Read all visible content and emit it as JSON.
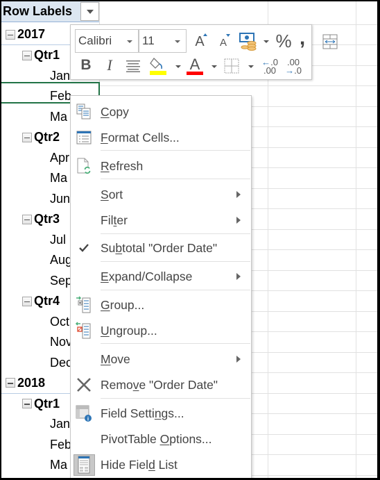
{
  "pivot": {
    "header_label": "Row Labels",
    "rows": [
      {
        "type": "year",
        "label": "2017"
      },
      {
        "type": "qtr",
        "label": "Qtr1"
      },
      {
        "type": "month",
        "label": "Jan"
      },
      {
        "type": "month",
        "label": "Feb"
      },
      {
        "type": "month",
        "label": "Ma"
      },
      {
        "type": "qtr",
        "label": "Qtr2"
      },
      {
        "type": "month",
        "label": "Apr"
      },
      {
        "type": "month",
        "label": "Ma"
      },
      {
        "type": "month",
        "label": "Jun"
      },
      {
        "type": "qtr",
        "label": "Qtr3"
      },
      {
        "type": "month",
        "label": "Jul"
      },
      {
        "type": "month",
        "label": "Aug"
      },
      {
        "type": "month",
        "label": "Sep"
      },
      {
        "type": "qtr",
        "label": "Qtr4"
      },
      {
        "type": "month",
        "label": "Oct"
      },
      {
        "type": "month",
        "label": "Nov"
      },
      {
        "type": "month",
        "label": "Dec"
      },
      {
        "type": "year",
        "label": "2018"
      },
      {
        "type": "qtr",
        "label": "Qtr1"
      },
      {
        "type": "month",
        "label": "Jan"
      },
      {
        "type": "month",
        "label": "Feb"
      },
      {
        "type": "month",
        "label": "Ma"
      }
    ]
  },
  "mini_toolbar": {
    "font_name": "Calibri",
    "font_size": "11",
    "highlight_color": "#ffff00",
    "font_color": "#ff0000",
    "buttons": {
      "increase_font": "A",
      "decrease_font": "A",
      "percent": "%",
      "comma": ",",
      "bold": "B",
      "italic": "I",
      "inc_decimal_top": ".0",
      "inc_decimal_bottom": ".00",
      "dec_decimal_top": ".00",
      "dec_decimal_bottom": ".0"
    }
  },
  "context_menu": {
    "items": [
      {
        "id": "copy",
        "pre": "",
        "u": "C",
        "post": "opy",
        "icon": "copy-icon"
      },
      {
        "id": "format-cells",
        "pre": "",
        "u": "F",
        "post": "ormat Cells...",
        "icon": "format-cells-icon"
      },
      {
        "id": "refresh",
        "pre": "",
        "u": "R",
        "post": "efresh",
        "icon": "refresh-icon"
      },
      {
        "id": "sort",
        "pre": "",
        "u": "S",
        "post": "ort",
        "submenu": true
      },
      {
        "id": "filter",
        "pre": "Fil",
        "u": "t",
        "post": "er",
        "submenu": true
      },
      {
        "id": "subtotal",
        "pre": "Su",
        "u": "b",
        "post": "total \"Order Date\"",
        "checked": true
      },
      {
        "id": "expand-collapse",
        "pre": "",
        "u": "E",
        "post": "xpand/Collapse",
        "submenu": true
      },
      {
        "id": "group",
        "pre": "",
        "u": "G",
        "post": "roup...",
        "icon": "group-icon"
      },
      {
        "id": "ungroup",
        "pre": "",
        "u": "U",
        "post": "ngroup...",
        "icon": "ungroup-icon"
      },
      {
        "id": "move",
        "pre": "",
        "u": "M",
        "post": "ove",
        "submenu": true
      },
      {
        "id": "remove",
        "pre": "Remo",
        "u": "v",
        "post": "e \"Order Date\"",
        "icon": "remove-icon"
      },
      {
        "id": "field-settings",
        "pre": "Field Setti",
        "u": "n",
        "post": "gs...",
        "icon": "field-settings-icon"
      },
      {
        "id": "pivottable-options",
        "pre": "PivotTable ",
        "u": "O",
        "post": "ptions..."
      },
      {
        "id": "hide-field-list",
        "pre": "Hide Fiel",
        "u": "d",
        "post": " List",
        "icon": "field-list-icon",
        "active": true
      }
    ]
  }
}
